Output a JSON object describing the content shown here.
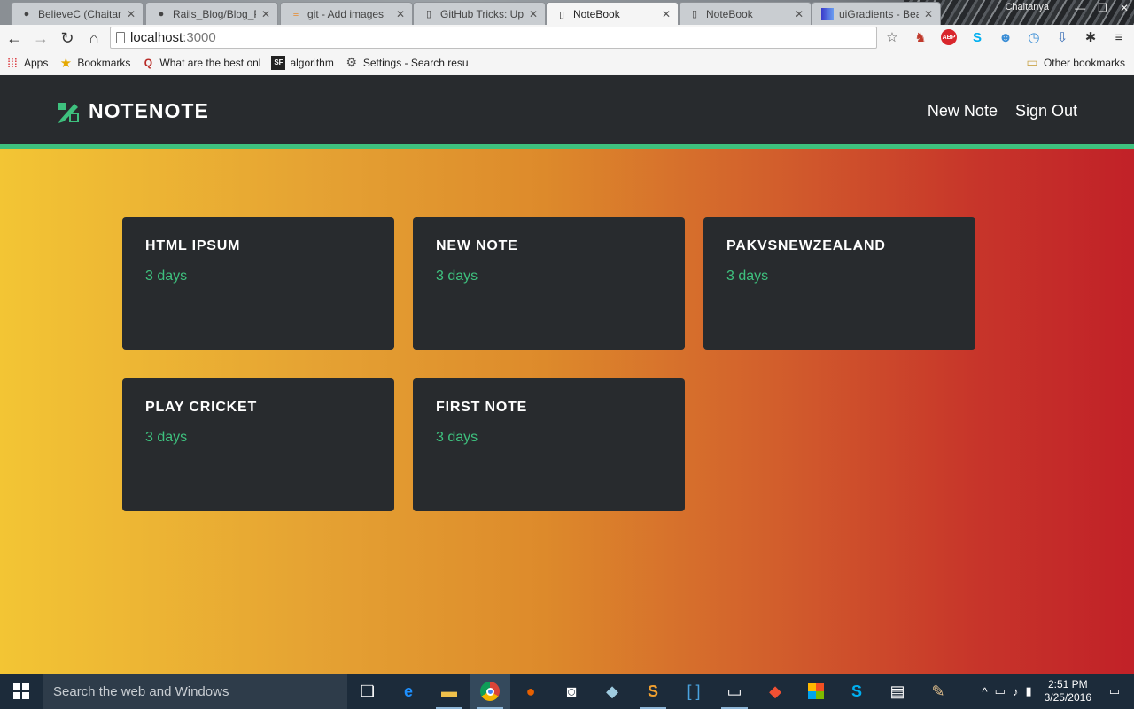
{
  "browser": {
    "tabs": [
      {
        "title": "BelieveC (Chaitany",
        "icon": "github-icon",
        "active": false
      },
      {
        "title": "Rails_Blog/Blog_P",
        "icon": "github-icon",
        "active": false
      },
      {
        "title": "git - Add images",
        "icon": "stackoverflow-icon",
        "active": false
      },
      {
        "title": "GitHub Tricks: Up",
        "icon": "page-icon",
        "active": false
      },
      {
        "title": "NoteBook",
        "icon": "page-icon",
        "active": true
      },
      {
        "title": "NoteBook",
        "icon": "page-icon",
        "active": false
      },
      {
        "title": "uiGradients - Bea",
        "icon": "uigradients-icon",
        "active": false
      }
    ],
    "user": "Chaitanya",
    "address": {
      "host": "localhost",
      "port": ":3000"
    },
    "bookmarks": [
      {
        "label": "Apps",
        "icon": "apps-grid-icon"
      },
      {
        "label": "Bookmarks",
        "icon": "star-icon"
      },
      {
        "label": "What are the best onl",
        "icon": "quora-icon"
      },
      {
        "label": "algorithm",
        "icon": "sf-icon"
      },
      {
        "label": "Settings - Search resu",
        "icon": "gear-icon"
      }
    ],
    "other_bookmarks": "Other bookmarks"
  },
  "app": {
    "brand": "NOTENOTE",
    "nav": {
      "new_note": "New Note",
      "sign_out": "Sign Out"
    },
    "accent": "#3ec17e",
    "notes": [
      {
        "title": "HTML IPSUM",
        "time": "3 days"
      },
      {
        "title": "NEW NOTE",
        "time": "3 days"
      },
      {
        "title": "PAKVSNEWZEALAND",
        "time": "3 days"
      },
      {
        "title": "PLAY CRICKET",
        "time": "3 days"
      },
      {
        "title": "FIRST NOTE",
        "time": "3 days"
      }
    ]
  },
  "taskbar": {
    "search_placeholder": "Search the web and Windows",
    "time": "2:51 PM",
    "date": "3/25/2016"
  }
}
